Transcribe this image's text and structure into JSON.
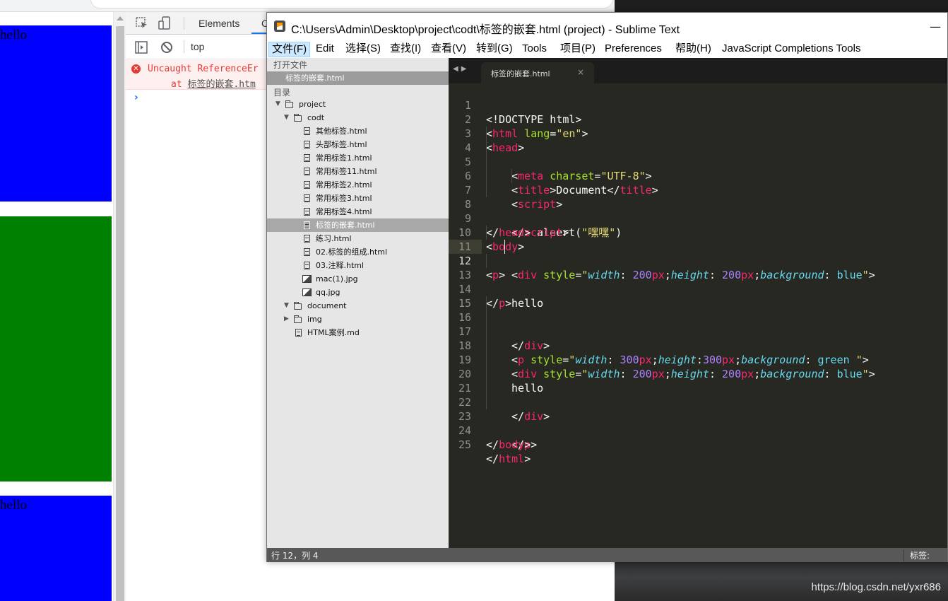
{
  "page": {
    "hello_text_1": "hello",
    "hello_text_2": "hello",
    "colors": {
      "blue": "#0000ff",
      "green": "#008000"
    }
  },
  "devtools": {
    "tabs": {
      "elements": "Elements",
      "console_partial": "C"
    },
    "context": "top",
    "error_line_1": "Uncaught ReferenceEr",
    "error_line_2_prefix": "at ",
    "error_line_2_link": "标签的嵌套.htm",
    "prompt": "›"
  },
  "sublime": {
    "title": "C:\\Users\\Admin\\Desktop\\project\\codt\\标签的嵌套.html (project) - Sublime Text",
    "minimize": "—",
    "menu": [
      "文件(F)",
      "Edit",
      "选择(S)",
      "查找(I)",
      "查看(V)",
      "转到(G)",
      "Tools",
      "项目(P)",
      "Preferences",
      "帮助(H)",
      "JavaScript Completions Tools"
    ],
    "sidebar": {
      "open_files_header": "打开文件",
      "open_file": "标签的嵌套.html",
      "folders_header": "目录",
      "tree": {
        "project": "project",
        "codt": "codt",
        "files": [
          "其他标签.html",
          "头部标签.html",
          "常用标签1.html",
          "常用标签11.html",
          "常用标签2.html",
          "常用标签3.html",
          "常用标签4.html",
          "标签的嵌套.html",
          "练习.html",
          "02.标签的组成.html",
          "03.注释.html"
        ],
        "images": [
          "mac(1).jpg",
          "qq.jpg"
        ],
        "document": "document",
        "img": "img",
        "md": "HTML案例.md"
      }
    },
    "tab": {
      "label": "标签的嵌套.html",
      "close": "×"
    },
    "code": {
      "line_numbers": [
        "1",
        "2",
        "3",
        "4",
        "5",
        "6",
        "7",
        "8",
        "9",
        "10",
        "11",
        "12",
        "13",
        "14",
        "15",
        "16",
        "17",
        "18",
        "19",
        "20",
        "21",
        "22",
        "23",
        "24",
        "25"
      ],
      "l1": "<!DOCTYPE html>",
      "html_tag": "html",
      "lang_attr": "lang",
      "lang_val": "\"en\"",
      "head": "head",
      "meta": "meta",
      "charset": "charset",
      "utf8": "\"UTF-8\"",
      "title": "title",
      "document": "Document",
      "script": "script",
      "aleert": "aleert(",
      "heihei": "\"嘿嘿\"",
      "paren": ")",
      "body": "body",
      "div": "div",
      "style": "style",
      "p": "p",
      "width": "width",
      "height": "height",
      "background": "background",
      "v200": "200",
      "v300": "300",
      "px": "px",
      "blue": "blue",
      "green": "green ",
      "hello": "hello"
    },
    "status": {
      "left": "行 12，列 4",
      "right": "标签:"
    }
  },
  "desktop": {
    "watermark": "https://blog.csdn.net/yxr686"
  }
}
